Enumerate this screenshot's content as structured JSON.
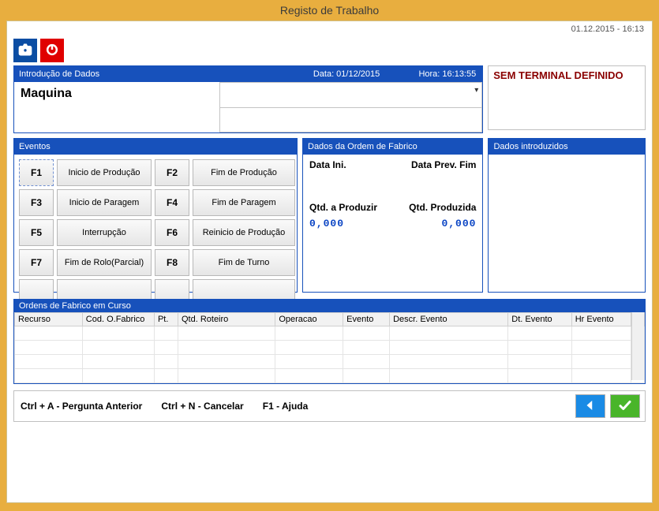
{
  "window_title": "Registo de Trabalho",
  "top_datetime": "01.12.2015 - 16:13",
  "intro": {
    "header_title": "Introdução de Dados",
    "header_date": "Data: 01/12/2015",
    "header_time": "Hora: 16:13:55",
    "label": "Maquina"
  },
  "terminal_warning": "SEM TERMINAL DEFINIDO",
  "panels": {
    "eventos_title": "Eventos",
    "dados_of_title": "Dados da Ordem de Fabrico",
    "dados_intro_title": "Dados introduzidos",
    "ordens_title": "Ordens de Fabrico em Curso"
  },
  "eventos": {
    "f1": {
      "key": "F1",
      "label": "Inicio de Produção"
    },
    "f2": {
      "key": "F2",
      "label": "Fim de Produção"
    },
    "f3": {
      "key": "F3",
      "label": "Inicio de Paragem"
    },
    "f4": {
      "key": "F4",
      "label": "Fim de Paragem"
    },
    "f5": {
      "key": "F5",
      "label": "Interrupção"
    },
    "f6": {
      "key": "F6",
      "label": "Reinicio de Produção"
    },
    "f7": {
      "key": "F7",
      "label": "Fim de Rolo(Parcial)"
    },
    "f8": {
      "key": "F8",
      "label": "Fim de Turno"
    }
  },
  "dados_of": {
    "data_ini_label": "Data Ini.",
    "data_prev_fim_label": "Data Prev. Fim",
    "qtd_prod_label": "Qtd. a Produzir",
    "qtd_produzida_label": "Qtd. Produzida",
    "qtd_prod_val": "0,000",
    "qtd_produzida_val": "0,000"
  },
  "orders_columns": {
    "c0": "Recurso",
    "c1": "Cod. O.Fabrico",
    "c2": "Pt.",
    "c3": "Qtd. Roteiro",
    "c4": "Operacao",
    "c5": "Evento",
    "c6": "Descr. Evento",
    "c7": "Dt. Evento",
    "c8": "Hr Evento"
  },
  "footer": {
    "prev": "Ctrl + A - Pergunta Anterior",
    "cancel": "Ctrl + N - Cancelar",
    "help": "F1 - Ajuda"
  },
  "icons": {
    "camera": "camera-icon",
    "power": "power-icon",
    "back": "back-icon",
    "confirm": "confirm-icon",
    "dropdown": "dropdown-caret-icon"
  }
}
